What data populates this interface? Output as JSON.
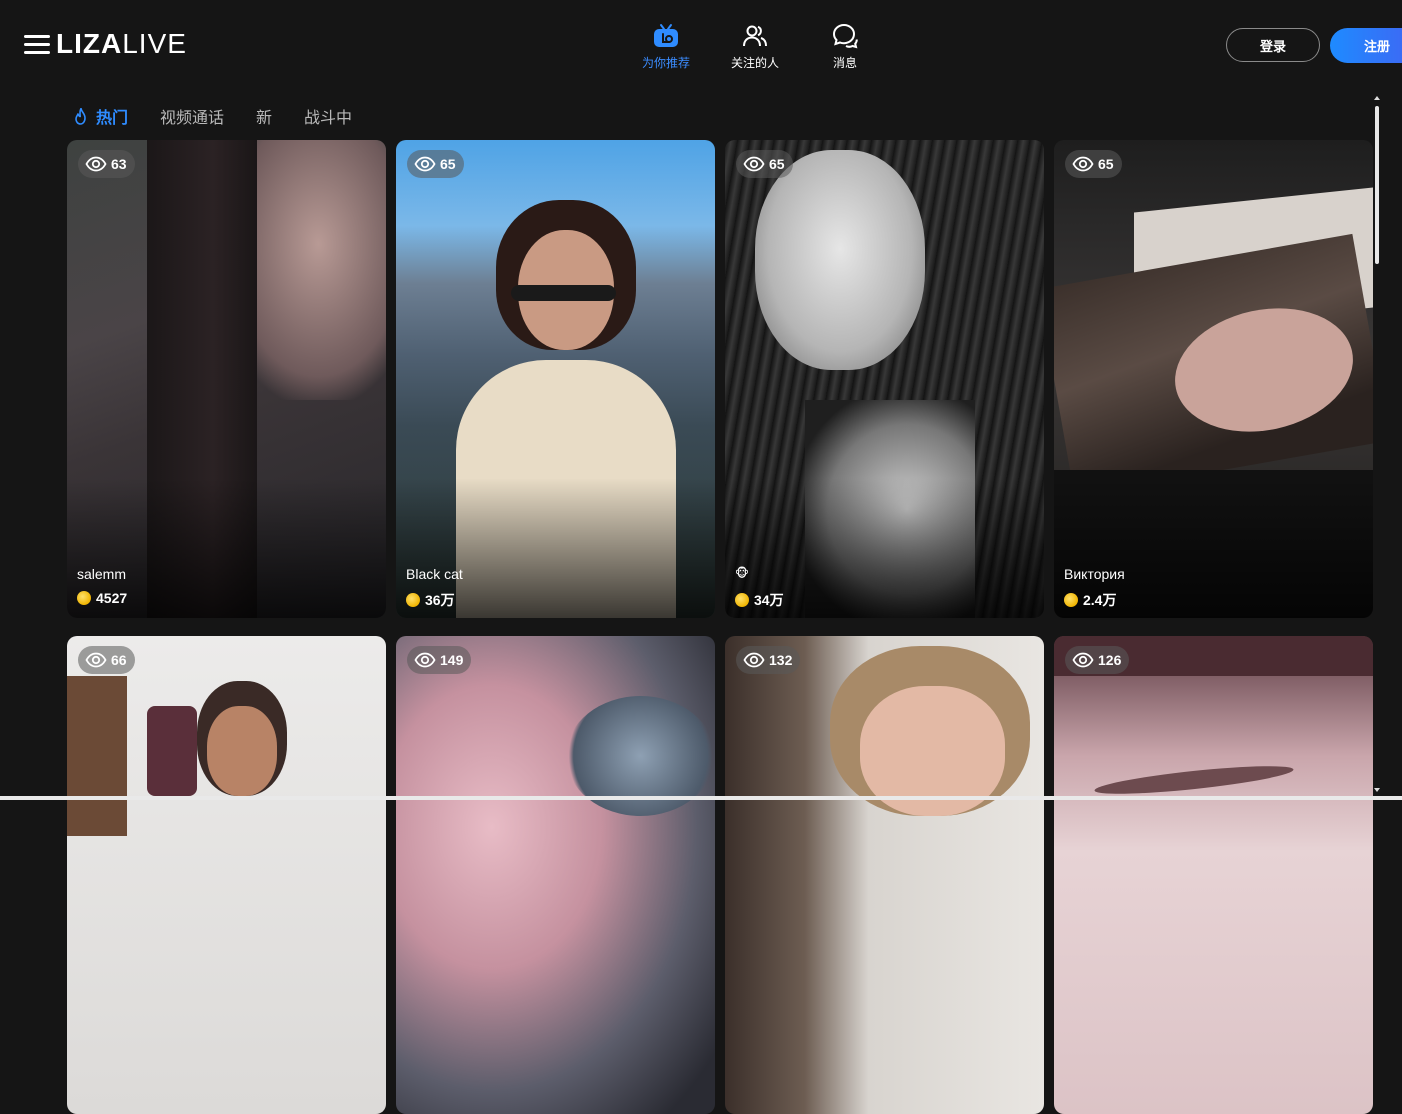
{
  "brand": {
    "logo_bold": "LIZA",
    "logo_light": "LIVE"
  },
  "nav": [
    {
      "label": "为你推荐",
      "icon": "tv-icon"
    },
    {
      "label": "关注的人",
      "icon": "users-icon"
    },
    {
      "label": "消息",
      "icon": "chat-icon"
    }
  ],
  "auth": {
    "login": "登录",
    "register": "注册"
  },
  "tabs": [
    "热门",
    "视频通话",
    "新",
    "战斗中"
  ],
  "colors": {
    "accent": "#2f8cff",
    "background": "#151515"
  },
  "streams": [
    {
      "viewers": "63",
      "name": "salemm",
      "coins": "4527"
    },
    {
      "viewers": "65",
      "name": "Black cat",
      "coins": "36万"
    },
    {
      "viewers": "65",
      "name": "🐵",
      "coins": "34万"
    },
    {
      "viewers": "65",
      "name": "Виктория",
      "coins": "2.4万"
    },
    {
      "viewers": "66"
    },
    {
      "viewers": "149"
    },
    {
      "viewers": "132"
    },
    {
      "viewers": "126"
    }
  ]
}
